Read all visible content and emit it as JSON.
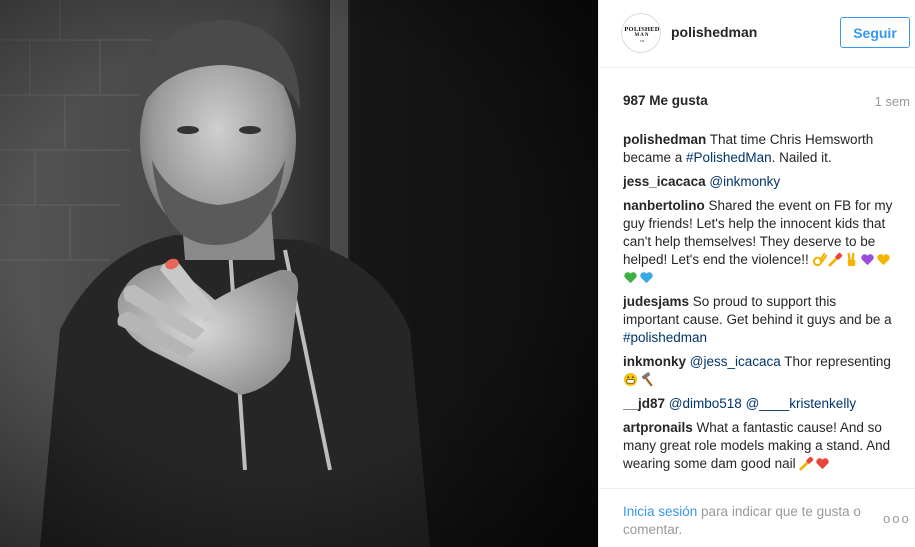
{
  "post": {
    "image_alt": "Black and white photo of Chris Hemsworth showing his hand with one polished fingernail",
    "author": "polishedman",
    "avatar_logo": {
      "line1": "POLISHED",
      "line2": "MAN",
      "line3": "TM"
    },
    "follow_label": "Seguir",
    "likes": "987 Me gusta",
    "time_ago": "1 sem",
    "accent_color": "#3897f0"
  },
  "comments": [
    {
      "user": "polishedman",
      "text_before": "That time Chris Hemsworth became a ",
      "link": "#PolishedMan",
      "text_after": ". Nailed it."
    },
    {
      "user": "jess_icacaca",
      "link": "@inkmonky"
    },
    {
      "user": "nanbertolino",
      "text": "Shared the event on FB for my guy friends! Let's help the innocent kids that can't help themselves! They deserve to be helped! Let's end the violence!!",
      "emojis": [
        "ok-hand-icon",
        "nail-polish-icon",
        "victory-hand-icon",
        "purple-heart-icon",
        "yellow-heart-icon",
        "green-heart-icon",
        "blue-heart-icon"
      ]
    },
    {
      "user": "judesjams",
      "text_before": "So proud to support this important cause. Get behind it guys and be a ",
      "link": "#polishedman"
    },
    {
      "user": "inkmonky",
      "link": "@jess_icacaca",
      "text_after": " Thor representing",
      "emojis": [
        "grinning-face-icon",
        "hammer-icon"
      ]
    },
    {
      "user": "__jd87",
      "link": "@dimbo518",
      "link2": "@____kristenkelly"
    },
    {
      "user": "artpronails",
      "text": "What a fantastic cause! And so many great role models making a stand. And wearing some dam good nail",
      "emojis": [
        "nail-polish-icon",
        "red-heart-icon"
      ]
    }
  ],
  "footer": {
    "login_link": "Inicia sesión",
    "login_rest": " para indicar que te gusta o comentar.",
    "more_label": "ooo"
  }
}
